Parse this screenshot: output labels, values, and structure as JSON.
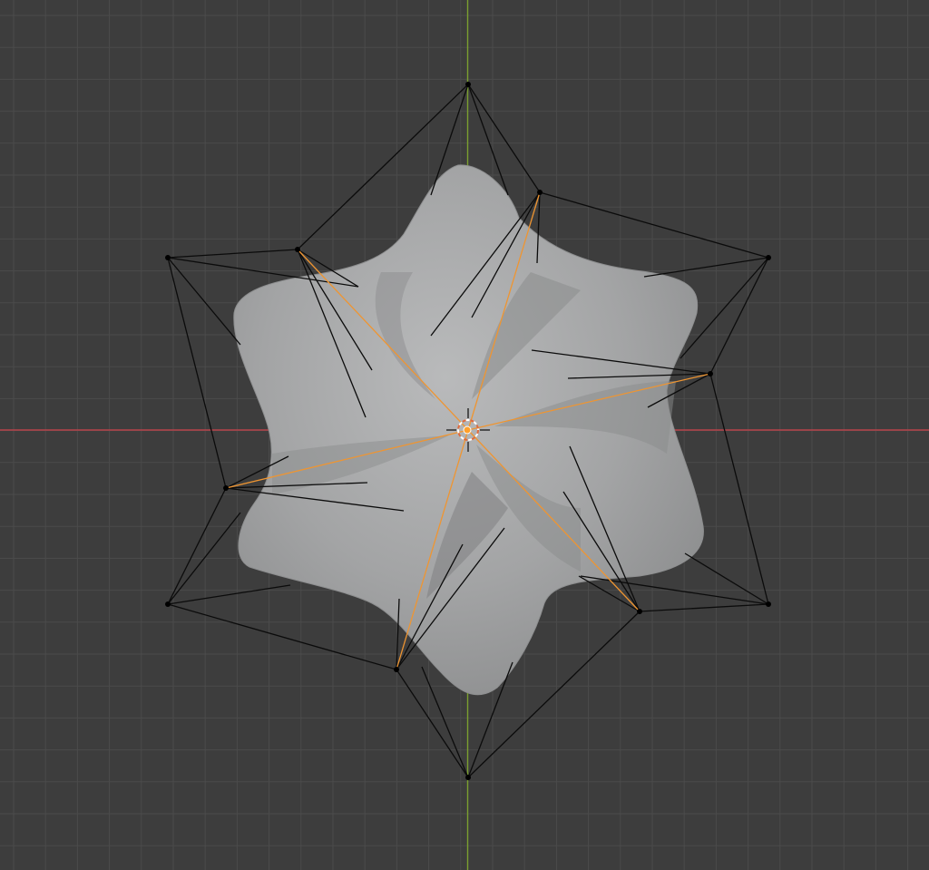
{
  "app": "3D viewport",
  "viewport": {
    "view": "front-orthographic",
    "background_color": "#3d3d3d",
    "grid_color": "#4a4a4a",
    "x_axis_color": "#c0424b",
    "y_axis_color": "#7aa32e"
  },
  "object": {
    "kind": "subdivided-surface-mesh",
    "shape": "twisted-six-point-star",
    "surface_color": "#a8a9aa"
  },
  "cage": {
    "edge_color": "#0a0a0a",
    "vertex_color": "#000000",
    "selected_edge_color": "#f0962a"
  },
  "cursor_3d": {
    "colors": [
      "#e0603a",
      "#ffffff"
    ]
  },
  "origin": {
    "color": "#ff9f2a"
  }
}
